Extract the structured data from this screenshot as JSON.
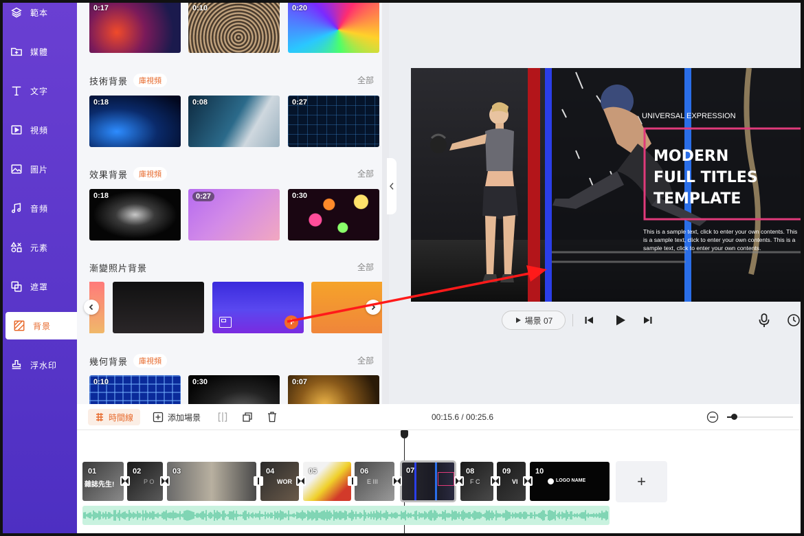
{
  "sidebar": {
    "items": [
      {
        "label": "範本",
        "icon": "layers-icon"
      },
      {
        "label": "媒體",
        "icon": "folder-add-icon"
      },
      {
        "label": "文字",
        "icon": "text-icon"
      },
      {
        "label": "視頻",
        "icon": "video-icon"
      },
      {
        "label": "圖片",
        "icon": "image-icon"
      },
      {
        "label": "音頻",
        "icon": "music-icon"
      },
      {
        "label": "元素",
        "icon": "elements-icon"
      },
      {
        "label": "遮罩",
        "icon": "mask-icon"
      },
      {
        "label": "背景",
        "icon": "background-icon",
        "active": true
      },
      {
        "label": "浮水印",
        "icon": "stamp-icon"
      }
    ]
  },
  "library": {
    "top_row": [
      "0:17",
      "0:10",
      "0:20"
    ],
    "sections": [
      {
        "title": "技術背景",
        "tag": "庫視頻",
        "all": "全部",
        "durations": [
          "0:18",
          "0:08",
          "0:27"
        ]
      },
      {
        "title": "效果背景",
        "tag": "庫視頻",
        "all": "全部",
        "durations": [
          "0:18",
          "0:27",
          "0:30"
        ]
      },
      {
        "title": "漸變照片背景",
        "all": "全部"
      },
      {
        "title": "幾何背景",
        "tag": "庫視頻",
        "all": "全部",
        "durations": [
          "0:10",
          "0:30",
          "0:07"
        ]
      }
    ],
    "add_symbol": "+"
  },
  "preview": {
    "overline": "UNIVERSAL EXPRESSION",
    "title_lines": [
      "MODERN",
      "FULL TITLES",
      "TEMPLATE"
    ],
    "body_lines": [
      "This is a sample text, click to enter your own contents. This",
      "is a sample text, click to enter your own contents. This is a",
      "sample text, click to enter your own contents."
    ]
  },
  "player": {
    "scene_label": "場景 07"
  },
  "timeline": {
    "timeline_label": "時間線",
    "add_scene_label": "添加場景",
    "time_display": "00:15.6 / 00:25.6",
    "zoom_level": 0.1,
    "clips": [
      {
        "num": "01",
        "caption": "雜誌先生!"
      },
      {
        "num": "02",
        "caption": "P O"
      },
      {
        "num": "03",
        "caption": ""
      },
      {
        "num": "04",
        "caption": "WOR"
      },
      {
        "num": "05",
        "caption": ""
      },
      {
        "num": "06",
        "caption": "E III"
      },
      {
        "num": "07",
        "caption": ""
      },
      {
        "num": "08",
        "caption": "F C"
      },
      {
        "num": "09",
        "caption": "VI"
      },
      {
        "num": "10",
        "caption": "LOGO NAME"
      }
    ],
    "add_clip": "+"
  },
  "colors": {
    "sidebar": "#5a35c9",
    "accent": "#e76a2c",
    "audio": "#c9f2df",
    "arrow": "#ff1a1a"
  }
}
